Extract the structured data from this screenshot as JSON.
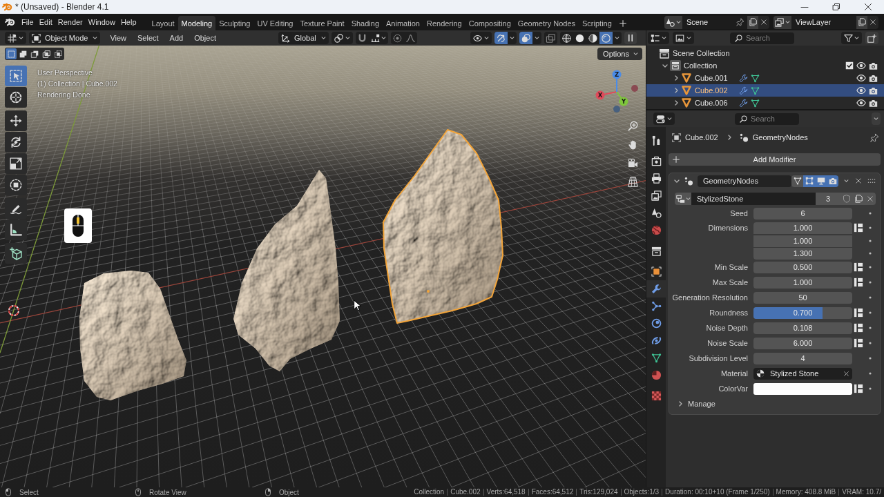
{
  "window": {
    "title": "* (Unsaved) - Blender 4.1"
  },
  "top_bar": {
    "menus": [
      "File",
      "Edit",
      "Render",
      "Window",
      "Help"
    ],
    "workspaces": [
      {
        "label": "Layout",
        "selected": false
      },
      {
        "label": "Modeling",
        "selected": true
      },
      {
        "label": "Sculpting",
        "selected": false
      },
      {
        "label": "UV Editing",
        "selected": false
      },
      {
        "label": "Texture Paint",
        "selected": false
      },
      {
        "label": "Shading",
        "selected": false
      },
      {
        "label": "Animation",
        "selected": false
      },
      {
        "label": "Rendering",
        "selected": false
      },
      {
        "label": "Compositing",
        "selected": false
      },
      {
        "label": "Geometry Nodes",
        "selected": false
      },
      {
        "label": "Scripting",
        "selected": false
      }
    ],
    "scene": "Scene",
    "view_layer": "ViewLayer"
  },
  "viewport": {
    "header": {
      "mode": "Object Mode",
      "menus": [
        "View",
        "Select",
        "Add",
        "Object"
      ],
      "orientation": "Global",
      "snapping": false,
      "proportional_editing": false,
      "toggles": [
        {
          "kind": "gizmos",
          "on": true
        },
        {
          "kind": "overlays",
          "on": true
        },
        {
          "kind": "xray",
          "on": false
        }
      ],
      "shading_modes": [
        {
          "kind": "wireframe",
          "selected": false
        },
        {
          "kind": "solid",
          "selected": false
        },
        {
          "kind": "material_preview",
          "selected": false
        },
        {
          "kind": "rendered",
          "selected": true
        }
      ]
    },
    "selection_modes": [
      {
        "kind": "set",
        "selected": true
      },
      {
        "kind": "extend",
        "selected": false
      },
      {
        "kind": "subtract",
        "selected": false
      },
      {
        "kind": "difference",
        "selected": false
      },
      {
        "kind": "intersect",
        "selected": false
      }
    ],
    "options": "Options",
    "info_text": [
      "User Perspective",
      "(1) Collection | Cube.002",
      "Rendering Done"
    ],
    "tools": [
      [
        {
          "kind": "select_box",
          "selected": true
        },
        {
          "kind": "cursor",
          "selected": false
        }
      ],
      [
        {
          "kind": "move",
          "selected": false
        },
        {
          "kind": "rotate",
          "selected": false
        },
        {
          "kind": "scale",
          "selected": false
        },
        {
          "kind": "transform",
          "selected": false
        }
      ],
      [
        {
          "kind": "annotate",
          "selected": false
        },
        {
          "kind": "measure",
          "selected": false
        }
      ],
      [
        {
          "kind": "add_cube",
          "selected": false
        }
      ]
    ],
    "gizmo_axes": [
      "X",
      "Y",
      "Z"
    ],
    "objects": [
      {
        "selected": false
      },
      {
        "selected": false
      },
      {
        "selected": true
      }
    ]
  },
  "outliner": {
    "search_placeholder": "Search",
    "tree": [
      {
        "label": "Scene Collection",
        "kind": "scene_collection",
        "selected": false,
        "children": [
          {
            "label": "Collection",
            "kind": "collection",
            "expanded": true,
            "selected": false,
            "checked": true,
            "visible": true,
            "renderable": true,
            "children": [
              {
                "label": "Cube.001",
                "kind": "mesh_object",
                "expanded": false,
                "selected": false,
                "visible": true,
                "renderable": true
              },
              {
                "label": "Cube.002",
                "kind": "mesh_object",
                "expanded": false,
                "selected": true,
                "visible": true,
                "renderable": true
              },
              {
                "label": "Cube.006",
                "kind": "mesh_object",
                "expanded": false,
                "selected": false,
                "visible": true,
                "renderable": true
              }
            ]
          }
        ]
      }
    ]
  },
  "properties": {
    "search_placeholder": "Search",
    "tabs": [
      [
        {
          "kind": "tool",
          "selected": false
        }
      ],
      [
        {
          "kind": "render",
          "selected": false
        },
        {
          "kind": "output",
          "selected": false
        },
        {
          "kind": "view_layer",
          "selected": false
        },
        {
          "kind": "scene",
          "selected": false
        },
        {
          "kind": "world",
          "selected": false
        }
      ],
      [
        {
          "kind": "collection",
          "selected": false
        }
      ],
      [
        {
          "kind": "object",
          "selected": false
        },
        {
          "kind": "modifiers",
          "selected": true
        },
        {
          "kind": "particles",
          "selected": false
        },
        {
          "kind": "physics",
          "selected": false
        },
        {
          "kind": "constraints",
          "selected": false
        },
        {
          "kind": "data",
          "selected": false
        },
        {
          "kind": "material",
          "selected": false
        }
      ],
      [
        {
          "kind": "texture",
          "selected": false
        }
      ]
    ],
    "breadcrumb": [
      "Cube.002",
      "GeometryNodes"
    ],
    "add_modifier": "Add Modifier",
    "modifier": {
      "name": "GeometryNodes",
      "expanded": true,
      "toggles": [
        {
          "kind": "on_cage",
          "on": false
        },
        {
          "kind": "edit_mode",
          "on": true
        },
        {
          "kind": "viewport",
          "on": true
        },
        {
          "kind": "render",
          "on": true
        }
      ],
      "node_group": "StylizedStone",
      "users": "3",
      "inputs": [
        {
          "label": "Seed",
          "kind": "number",
          "values": [
            "6"
          ],
          "attribute_toggle": false
        },
        {
          "label": "Dimensions",
          "kind": "vector",
          "values": [
            "1.000",
            "1.000",
            "1.300"
          ],
          "attribute_toggle": true
        },
        {
          "label": "Min Scale",
          "kind": "number",
          "values": [
            "0.500"
          ],
          "attribute_toggle": true
        },
        {
          "label": "Max Scale",
          "kind": "number",
          "values": [
            "1.000"
          ],
          "attribute_toggle": true
        },
        {
          "label": "Generation Resolution",
          "kind": "number",
          "values": [
            "50"
          ],
          "attribute_toggle": false
        },
        {
          "label": "Roundness",
          "kind": "slider",
          "values": [
            "0.700"
          ],
          "level": 0.7,
          "attribute_toggle": true
        },
        {
          "label": "Noise Depth",
          "kind": "number",
          "values": [
            "0.108"
          ],
          "attribute_toggle": true
        },
        {
          "label": "Noise Scale",
          "kind": "number",
          "values": [
            "6.000"
          ],
          "attribute_toggle": true
        },
        {
          "label": "Subdivision Level",
          "kind": "number",
          "values": [
            "4"
          ],
          "attribute_toggle": false
        },
        {
          "label": "Material",
          "kind": "material",
          "values": [
            "Stylized Stone"
          ],
          "attribute_toggle": false
        },
        {
          "label": "ColorVar",
          "kind": "color",
          "color": "#ffffff",
          "attribute_toggle": true
        }
      ],
      "manage": {
        "label": "Manage",
        "expanded": false
      }
    }
  },
  "status_bar": {
    "hints": [
      {
        "kind": "left_click",
        "label": "Select"
      },
      {
        "kind": "middle_click",
        "label": "Rotate View"
      },
      {
        "kind": "right_click",
        "label": "Object"
      }
    ],
    "stats": [
      "Collection",
      "Cube.002",
      "Verts:64,518",
      "Faces:64,512",
      "Tris:129,024",
      "Objects:1/3",
      "Duration: 00:10+10 (Frame 1/250)",
      "Memory: 408.8 MiB",
      "VRAM: 10.7/"
    ]
  }
}
